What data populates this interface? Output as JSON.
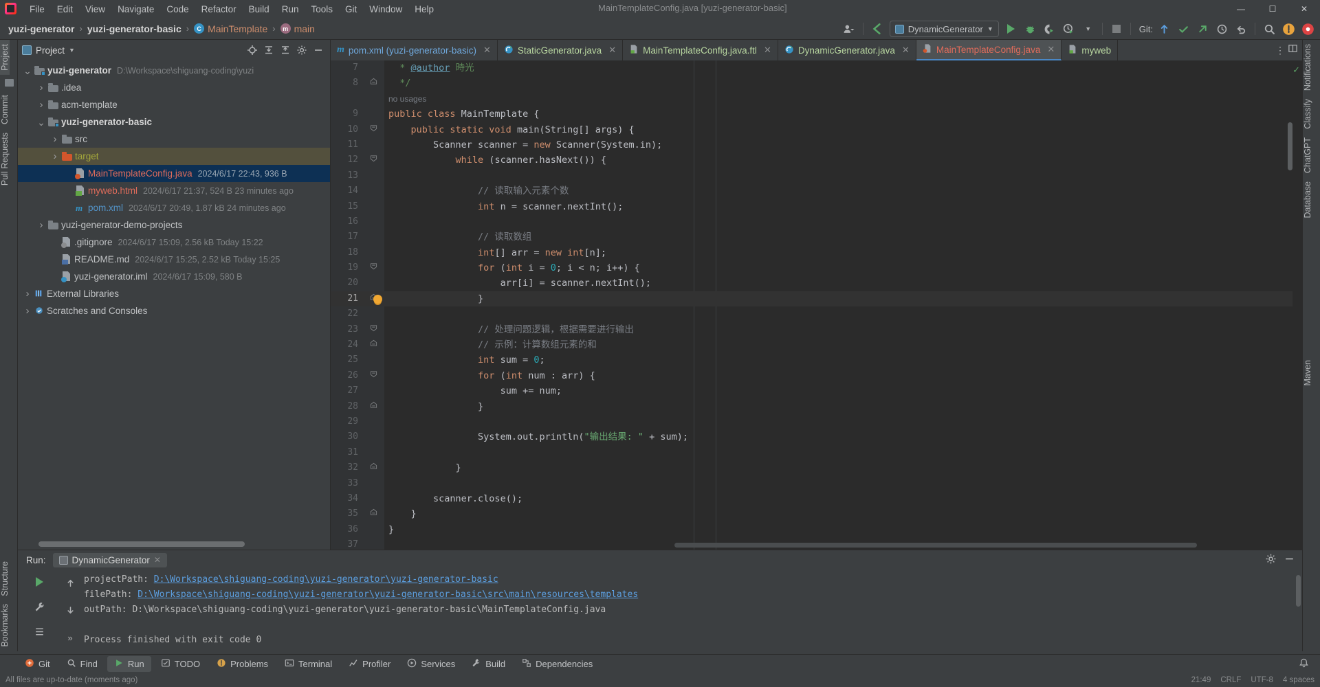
{
  "app": {
    "window_title": "MainTemplateConfig.java [yuzi-generator-basic]"
  },
  "menubar": {
    "items": [
      "File",
      "Edit",
      "View",
      "Navigate",
      "Code",
      "Refactor",
      "Build",
      "Run",
      "Tools",
      "Git",
      "Window",
      "Help"
    ],
    "window_controls": [
      "—",
      "☐",
      "✕"
    ]
  },
  "breadcrumb": {
    "project": "yuzi-generator",
    "module": "yuzi-generator-basic",
    "class": "MainTemplate",
    "method": "main",
    "class_badge": "C",
    "method_badge": "m",
    "separator": "›"
  },
  "toolbar": {
    "run_config": "DynamicGenerator",
    "git_label": "Git:",
    "buttons": [
      "user-icon",
      "back-arrow",
      "run",
      "debug",
      "run-coverage",
      "profiler",
      "stop",
      "git-update",
      "git-commit",
      "git-push",
      "history",
      "undo",
      "search",
      "updates",
      "settings"
    ]
  },
  "left_strip": {
    "top_tabs": [
      "Project",
      "Commit",
      "Pull Requests"
    ],
    "bottom_tabs": [
      "Structure",
      "Bookmarks"
    ],
    "active": "Project"
  },
  "right_strip": {
    "tabs": [
      "Notifications",
      "Classify",
      "ChatGPT",
      "Database",
      "Maven"
    ]
  },
  "project_panel": {
    "title": "Project",
    "actions": [
      "locate-icon",
      "expand-all-icon",
      "collapse-all-icon",
      "settings-icon",
      "hide-icon"
    ],
    "tree": [
      {
        "depth": 0,
        "arrow": "down",
        "icon": "module-folder",
        "label": "yuzi-generator",
        "bold": true,
        "color": "plain",
        "meta": "D:\\Workspace\\shiguang-coding\\yuzi",
        "sel": "none"
      },
      {
        "depth": 1,
        "arrow": "right",
        "icon": "folder",
        "label": ".idea",
        "bold": false,
        "color": "plain",
        "meta": "",
        "sel": "none"
      },
      {
        "depth": 1,
        "arrow": "right",
        "icon": "folder",
        "label": "acm-template",
        "bold": false,
        "color": "plain",
        "meta": "",
        "sel": "none"
      },
      {
        "depth": 1,
        "arrow": "down",
        "icon": "module-folder",
        "label": "yuzi-generator-basic",
        "bold": true,
        "color": "plain",
        "meta": "",
        "sel": "none"
      },
      {
        "depth": 2,
        "arrow": "right",
        "icon": "folder",
        "label": "src",
        "bold": false,
        "color": "plain",
        "meta": "",
        "sel": "none"
      },
      {
        "depth": 2,
        "arrow": "right",
        "icon": "folder-orange",
        "label": "target",
        "bold": false,
        "color": "olive",
        "meta": "",
        "sel": "olive"
      },
      {
        "depth": 3,
        "arrow": "none",
        "icon": "java-file",
        "label": "MainTemplateConfig.java",
        "bold": false,
        "color": "red",
        "meta": "2024/6/17 22:43, 936 B",
        "sel": "blue"
      },
      {
        "depth": 3,
        "arrow": "none",
        "icon": "html-file",
        "label": "myweb.html",
        "bold": false,
        "color": "red",
        "meta": "2024/6/17 21:37, 524 B 23 minutes ago",
        "sel": "none"
      },
      {
        "depth": 3,
        "arrow": "none",
        "icon": "maven-file",
        "label": "pom.xml",
        "bold": false,
        "color": "blue",
        "meta": "2024/6/17 20:49, 1.87 kB 24 minutes ago",
        "sel": "none"
      },
      {
        "depth": 1,
        "arrow": "right",
        "icon": "folder",
        "label": "yuzi-generator-demo-projects",
        "bold": false,
        "color": "plain",
        "meta": "",
        "sel": "none"
      },
      {
        "depth": 2,
        "arrow": "none",
        "icon": "gitignore-file",
        "label": ".gitignore",
        "bold": false,
        "color": "plain",
        "meta": "2024/6/17 15:09, 2.56 kB Today 15:22",
        "sel": "none"
      },
      {
        "depth": 2,
        "arrow": "none",
        "icon": "md-file",
        "label": "README.md",
        "bold": false,
        "color": "plain",
        "meta": "2024/6/17 15:25, 2.52 kB Today 15:25",
        "sel": "none"
      },
      {
        "depth": 2,
        "arrow": "none",
        "icon": "iml-file",
        "label": "yuzi-generator.iml",
        "bold": false,
        "color": "plain",
        "meta": "2024/6/17 15:09, 580 B",
        "sel": "none"
      },
      {
        "depth": 0,
        "arrow": "right",
        "icon": "library",
        "label": "External Libraries",
        "bold": false,
        "color": "plain",
        "meta": "",
        "sel": "none"
      },
      {
        "depth": 0,
        "arrow": "right",
        "icon": "scratches",
        "label": "Scratches and Consoles",
        "bold": false,
        "color": "plain",
        "meta": "",
        "sel": "none"
      }
    ]
  },
  "editor": {
    "tabs": [
      {
        "label": "pom.xml (yuzi-generator-basic)",
        "icon": "maven-icon",
        "color": "blue",
        "active": false,
        "close": "✕"
      },
      {
        "label": "StaticGenerator.java",
        "icon": "class-icon",
        "color": "green",
        "active": false,
        "close": "✕"
      },
      {
        "label": "MainTemplateConfig.java.ftl",
        "icon": "ftl-icon",
        "color": "green",
        "active": false,
        "close": "✕"
      },
      {
        "label": "DynamicGenerator.java",
        "icon": "class-icon",
        "color": "green",
        "active": false,
        "close": "✕"
      },
      {
        "label": "MainTemplateConfig.java",
        "icon": "java-icon",
        "color": "red",
        "active": true,
        "close": "✕"
      },
      {
        "label": "myweb",
        "icon": "html-icon",
        "color": "green",
        "active": false,
        "close": ""
      }
    ],
    "no_usages_hint": "no usages",
    "lines": [
      {
        "n": "7",
        "fold": "",
        "cur": false,
        "html": "  <span class='doc'>* </span><span class='anno'>@author</span><span class='doc'> 時光</span>"
      },
      {
        "n": "8",
        "fold": "end",
        "cur": false,
        "html": "  <span class='doc'>*/</span>"
      },
      {
        "n": "",
        "fold": "",
        "cur": false,
        "html": "<span class='nousage'>no usages</span>"
      },
      {
        "n": "9",
        "fold": "",
        "cur": false,
        "html": "<span class='kw'>public class </span><span class='cls-n'>MainTemplate </span><span class='pln'>{</span>"
      },
      {
        "n": "10",
        "fold": "open",
        "cur": false,
        "html": "    <span class='kw'>public static void </span><span class='fn'>main</span><span class='pln'>(String[] args) {</span>"
      },
      {
        "n": "11",
        "fold": "",
        "cur": false,
        "html": "        <span class='pln'>Scanner scanner = </span><span class='kw'>new </span><span class='pln'>Scanner(System.in);</span>"
      },
      {
        "n": "12",
        "fold": "open",
        "cur": false,
        "html": "            <span class='kw'>while </span><span class='pln'>(scanner.hasNext()) {</span>"
      },
      {
        "n": "13",
        "fold": "",
        "cur": false,
        "html": ""
      },
      {
        "n": "14",
        "fold": "",
        "cur": false,
        "html": "                <span class='cmt'>// 读取输入元素个数</span>"
      },
      {
        "n": "15",
        "fold": "",
        "cur": false,
        "html": "                <span class='kw'>int </span><span class='pln'>n = scanner.nextInt();</span>"
      },
      {
        "n": "16",
        "fold": "",
        "cur": false,
        "html": ""
      },
      {
        "n": "17",
        "fold": "",
        "cur": false,
        "html": "                <span class='cmt'>// 读取数组</span>"
      },
      {
        "n": "18",
        "fold": "",
        "cur": false,
        "html": "                <span class='kw'>int</span><span class='pln'>[] arr = </span><span class='kw'>new int</span><span class='pln'>[n];</span>"
      },
      {
        "n": "19",
        "fold": "open",
        "cur": false,
        "html": "                <span class='kw'>for </span><span class='pln'>(</span><span class='kw'>int </span><span class='pln'>i = </span><span class='num-l'>0</span><span class='pln'>; i &lt; n; i++) {</span>"
      },
      {
        "n": "20",
        "fold": "",
        "cur": false,
        "html": "                    <span class='pln'>arr[i] = scanner.nextInt();</span>"
      },
      {
        "n": "21",
        "fold": "end",
        "cur": true,
        "html": "                <span class='pln'>}</span>"
      },
      {
        "n": "22",
        "fold": "",
        "cur": false,
        "html": ""
      },
      {
        "n": "23",
        "fold": "open",
        "cur": false,
        "html": "                <span class='cmt'>// 处理问题逻辑，根据需要进行输出</span>"
      },
      {
        "n": "24",
        "fold": "end",
        "cur": false,
        "html": "                <span class='cmt'>// 示例：计算数组元素的和</span>"
      },
      {
        "n": "25",
        "fold": "",
        "cur": false,
        "html": "                <span class='kw'>int </span><span class='pln'>sum = </span><span class='num-l'>0</span><span class='pln'>;</span>"
      },
      {
        "n": "26",
        "fold": "open",
        "cur": false,
        "html": "                <span class='kw'>for </span><span class='pln'>(</span><span class='kw'>int </span><span class='pln'>num : arr) {</span>"
      },
      {
        "n": "27",
        "fold": "",
        "cur": false,
        "html": "                    <span class='pln'>sum += num;</span>"
      },
      {
        "n": "28",
        "fold": "end",
        "cur": false,
        "html": "                <span class='pln'>}</span>"
      },
      {
        "n": "29",
        "fold": "",
        "cur": false,
        "html": ""
      },
      {
        "n": "30",
        "fold": "",
        "cur": false,
        "html": "                <span class='pln'>System.out.println(</span><span class='str'>\"输出结果: \"</span><span class='pln'> + sum);</span>"
      },
      {
        "n": "31",
        "fold": "",
        "cur": false,
        "html": ""
      },
      {
        "n": "32",
        "fold": "end",
        "cur": false,
        "html": "            <span class='pln'>}</span>"
      },
      {
        "n": "33",
        "fold": "",
        "cur": false,
        "html": ""
      },
      {
        "n": "34",
        "fold": "",
        "cur": false,
        "html": "        <span class='pln'>scanner.close();</span>"
      },
      {
        "n": "35",
        "fold": "end",
        "cur": false,
        "html": "    <span class='pln'>}</span>"
      },
      {
        "n": "36",
        "fold": "",
        "cur": false,
        "html": "<span class='pln'>}</span>"
      },
      {
        "n": "37",
        "fold": "",
        "cur": false,
        "html": ""
      }
    ]
  },
  "run_panel": {
    "label": "Run:",
    "tab": "DynamicGenerator",
    "close": "✕",
    "console": [
      {
        "label": "projectPath: ",
        "link": "D:\\Workspace\\shiguang-coding\\yuzi-generator\\yuzi-generator-basic",
        "plain": ""
      },
      {
        "label": "filePath: ",
        "link": "D:\\Workspace\\shiguang-coding\\yuzi-generator\\yuzi-generator-basic\\src\\main\\resources\\templates",
        "plain": ""
      },
      {
        "label": "outPath: ",
        "link": "",
        "plain": "D:\\Workspace\\shiguang-coding\\yuzi-generator\\yuzi-generator-basic\\MainTemplateConfig.java"
      },
      {
        "label": "",
        "link": "",
        "plain": ""
      },
      {
        "label": "",
        "link": "",
        "plain": "Process finished with exit code 0"
      }
    ]
  },
  "statusbar": {
    "items": [
      {
        "label": "Git",
        "icon": "git-icon",
        "active": false
      },
      {
        "label": "Find",
        "icon": "search-icon",
        "active": false
      },
      {
        "label": "Run",
        "icon": "run-icon",
        "active": true
      },
      {
        "label": "TODO",
        "icon": "todo-icon",
        "active": false
      },
      {
        "label": "Problems",
        "icon": "problems-icon",
        "active": false
      },
      {
        "label": "Terminal",
        "icon": "terminal-icon",
        "active": false
      },
      {
        "label": "Profiler",
        "icon": "profiler-icon",
        "active": false
      },
      {
        "label": "Services",
        "icon": "services-icon",
        "active": false
      },
      {
        "label": "Build",
        "icon": "build-icon",
        "active": false
      },
      {
        "label": "Dependencies",
        "icon": "dependencies-icon",
        "active": false
      }
    ]
  },
  "bottombar": {
    "left": "All files are up-to-date (moments ago)",
    "right": [
      "21:49",
      "CRLF",
      "UTF-8",
      "4 spaces"
    ]
  },
  "colors": {
    "accent_blue": "#3592c4",
    "run_green": "#59a869",
    "selection_blue": "#0d3054",
    "selection_olive": "#53503d",
    "editor_bg": "#2b2b2b",
    "panel_bg": "#3c3f41",
    "string_green": "#6aab73",
    "keyword_orange": "#cf8e6d"
  }
}
